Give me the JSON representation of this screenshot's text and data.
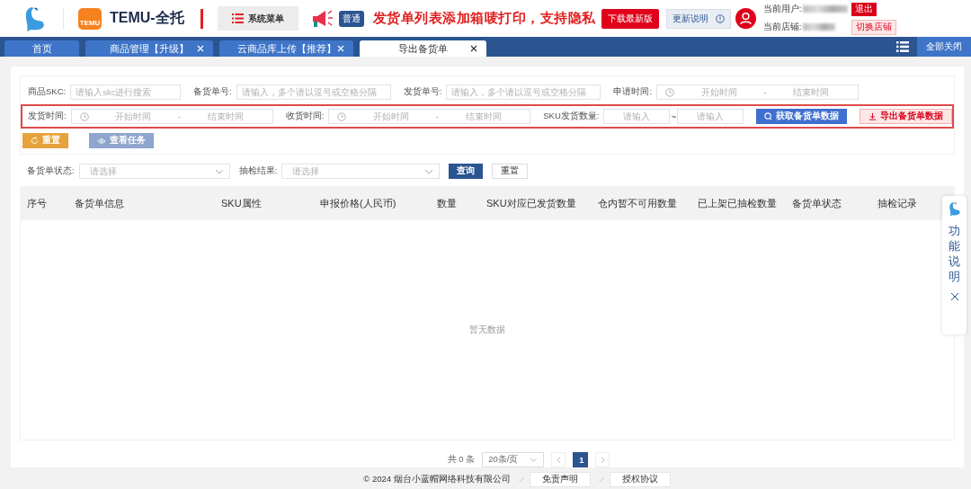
{
  "header": {
    "logo_text": "TEMU",
    "app_title": "TEMU-全托",
    "system_menu": "系统菜单",
    "badge": "普通",
    "announcement": "发货单列表添加箱唛打印，支持隐私",
    "download_button": "下载最新版",
    "update_button": "更新说明",
    "user_label": "当前用户:",
    "logout_button": "退出",
    "store_label": "当前店铺:",
    "switch_store_button": "切换店铺"
  },
  "tabs": [
    {
      "label": "首页",
      "selected": false,
      "closable": false
    },
    {
      "label": "商品管理【升级】",
      "selected": false,
      "closable": true
    },
    {
      "label": "云商品库上传【推荐】",
      "selected": false,
      "closable": true
    },
    {
      "label": "导出备货单",
      "selected": true,
      "closable": true
    }
  ],
  "close_all_button": "全部关闭",
  "filters": {
    "rows": [
      {
        "highlighted": false,
        "fields": [
          {
            "kind": "text",
            "label": "商品SKC:",
            "placeholder": "请输入skc进行搜索"
          },
          {
            "kind": "text",
            "label": "备货单号:",
            "placeholder": "请输入，多个请以逗号或空格分隔"
          },
          {
            "kind": "text",
            "label": "发货单号:",
            "placeholder": "请输入，多个请以逗号或空格分隔"
          },
          {
            "kind": "daterange",
            "label": "申请时间:",
            "start_placeholder": "开始时间",
            "separator": "-",
            "end_placeholder": "结束时间"
          }
        ]
      },
      {
        "highlighted": true,
        "fields": [
          {
            "kind": "daterange",
            "label": "发货时间:",
            "start_placeholder": "开始时间",
            "separator": "-",
            "end_placeholder": "结束时间"
          },
          {
            "kind": "daterange",
            "label": "收货时间:",
            "start_placeholder": "开始时间",
            "separator": "-",
            "end_placeholder": "结束时间"
          },
          {
            "kind": "numrange",
            "label": "SKU发货数量:",
            "min_placeholder": "请输入",
            "separator": "~",
            "max_placeholder": "请输入"
          },
          {
            "kind": "button",
            "label": "获取备货单数据"
          },
          {
            "kind": "button",
            "label": "导出备货单数据"
          }
        ]
      }
    ],
    "actions": [
      {
        "label": "重置"
      },
      {
        "label": "查看任务"
      }
    ]
  },
  "status_filters": [
    {
      "kind": "select",
      "label": "备货单状态:",
      "placeholder": "请选择"
    },
    {
      "kind": "select",
      "label": "抽检结果:",
      "placeholder": "请选择"
    },
    {
      "kind": "button",
      "label": "查询"
    },
    {
      "kind": "button",
      "label": "重置"
    }
  ],
  "table": {
    "columns": [
      "序号",
      "备货单信息",
      "SKU属性",
      "申报价格(人民币)",
      "数量",
      "SKU对应已发货数量",
      "仓内暂不可用数量",
      "已上架已抽检数量",
      "备货单状态",
      "抽检记录"
    ],
    "empty_text": "暂无数据"
  },
  "pagination": {
    "total": "共 0 条",
    "page_size": "20条/页",
    "pages": [
      {
        "label": "1",
        "selected": true
      }
    ]
  },
  "footer": {
    "copyright": "© 2024 烟台小蓝帽网络科技有限公司",
    "links": [
      "免责声明",
      "授权协议"
    ]
  },
  "side_help": {
    "label": "功能说明"
  }
}
